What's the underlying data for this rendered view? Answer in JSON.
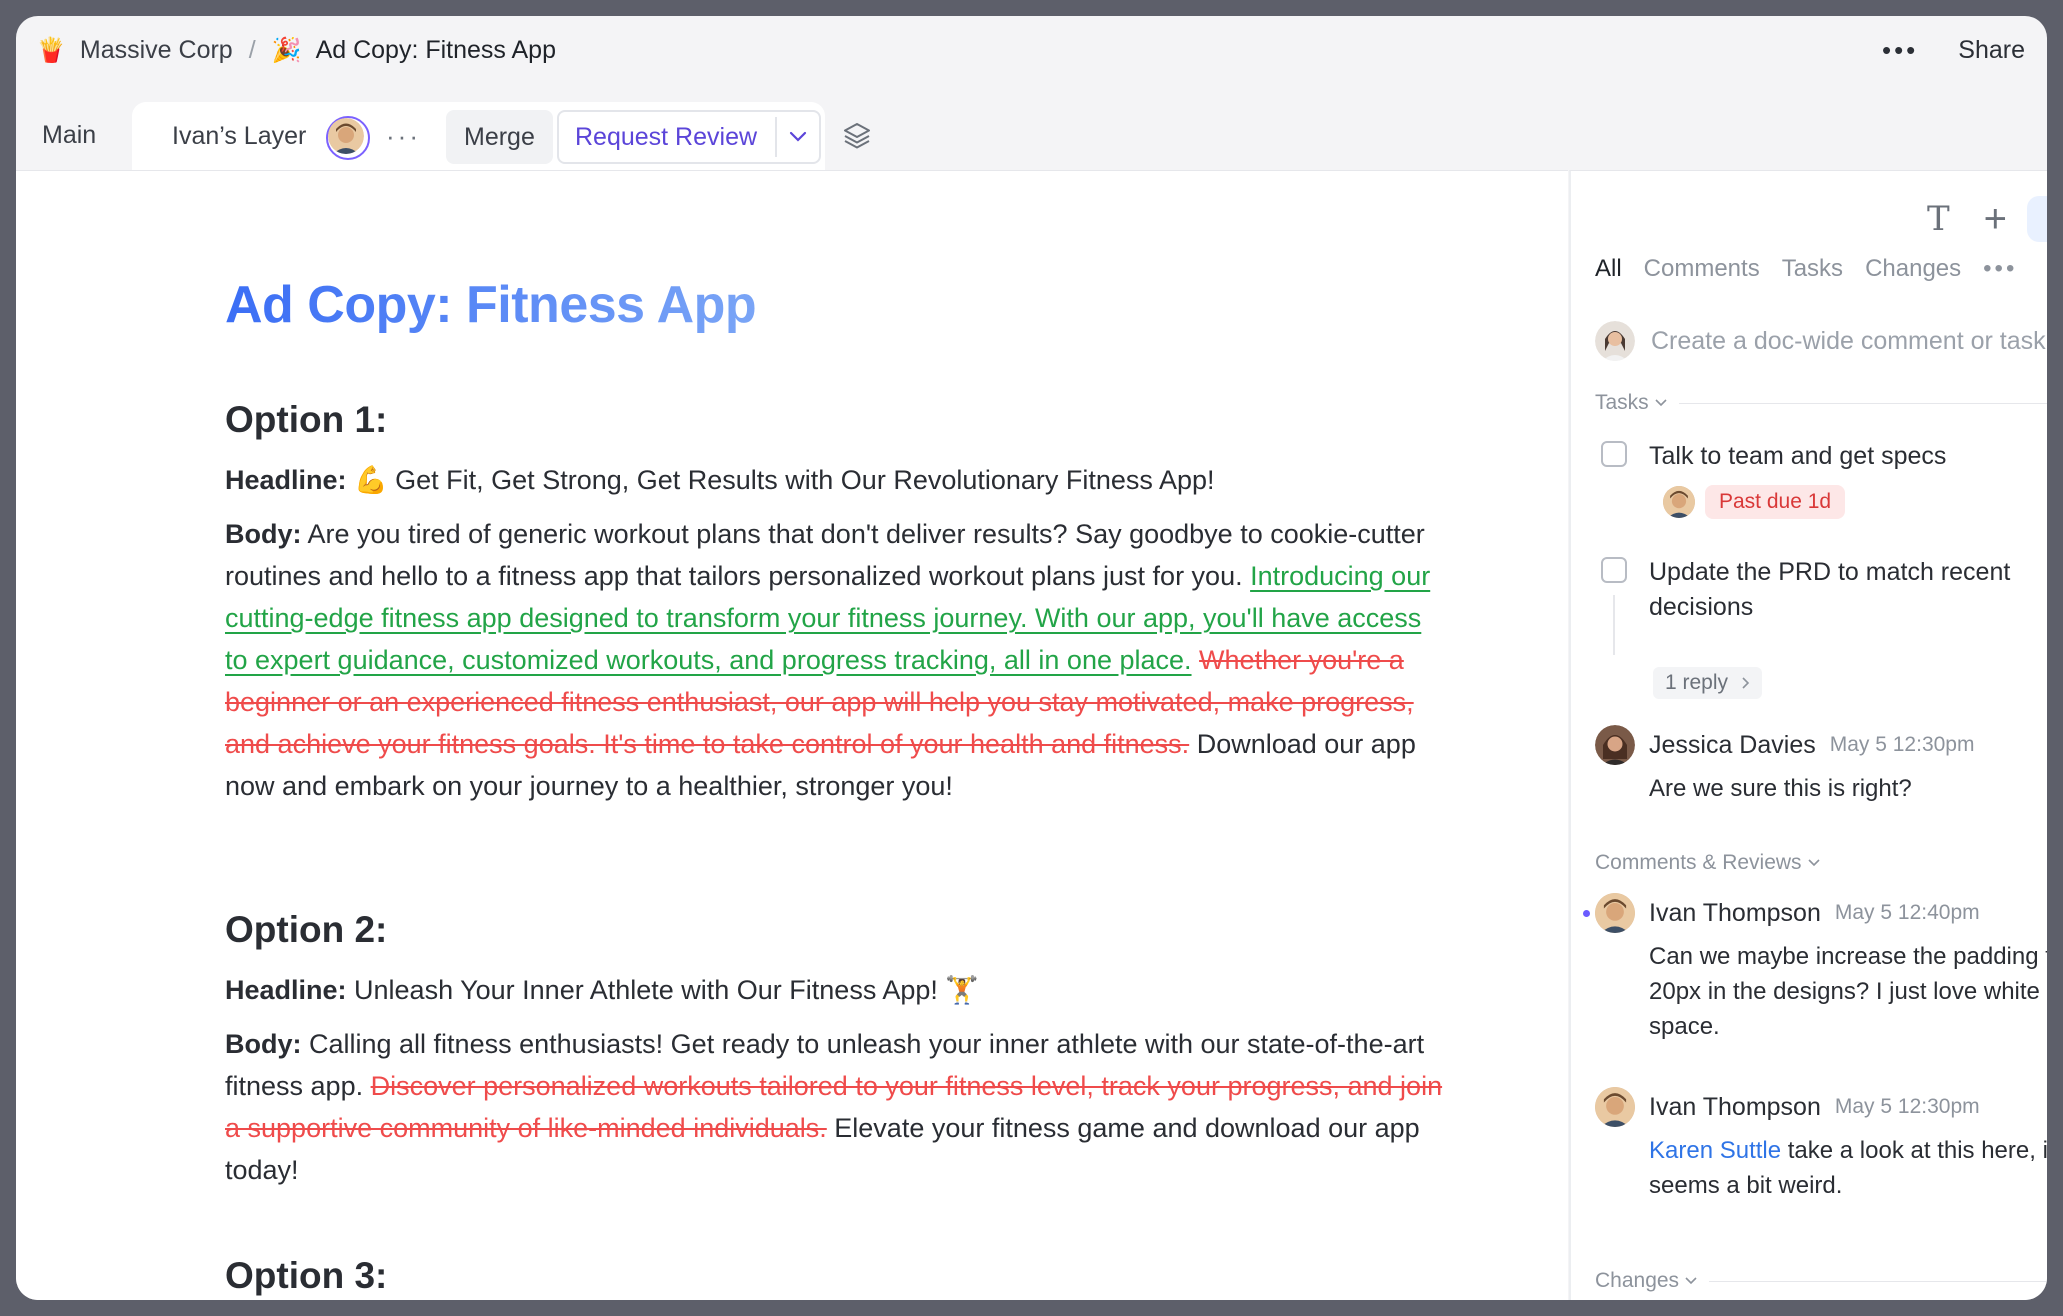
{
  "breadcrumb": {
    "workspace": "Massive Corp",
    "separator": "/",
    "document": "Ad Copy: Fitness App"
  },
  "topbar": {
    "more": "•••",
    "share": "Share"
  },
  "tabs": {
    "main": "Main",
    "layer": "Ivan’s Layer",
    "layer_more": "···",
    "merge": "Merge",
    "request_review": "Request Review"
  },
  "doc": {
    "title": "Ad Copy: Fitness App",
    "option1": {
      "heading": "Option 1:",
      "headline_label": "Headline:",
      "headline_text": " 💪 Get Fit, Get Strong, Get Results with Our Revolutionary Fitness App!",
      "body_label": "Body:",
      "body_plain1": " Are you tired of generic workout plans that don't deliver results? Say goodbye to cookie-cutter routines and hello to a fitness app that tailors personalized workout plans just for you. ",
      "body_inserted": "Introducing our cutting-edge fitness app designed to transform your fitness journey. With our app, you'll have access to expert guidance, customized workouts, and progress tracking, all in one place.",
      "body_space": " ",
      "body_deleted": "Whether you're a beginner or an experienced fitness enthusiast, our app will help you stay motivated, make progress, and achieve your fitness goals. It's time to take control of your health and fitness.",
      "body_plain2": " Download our app now and embark on your journey to a healthier, stronger you!"
    },
    "option2": {
      "heading": "Option 2:",
      "headline_label": "Headline:",
      "headline_text": " Unleash Your Inner Athlete with Our Fitness App! 🏋️",
      "body_label": "Body:",
      "body_plain1": " Calling all fitness enthusiasts! Get ready to unleash your inner athlete with our state-of-the-art fitness app. ",
      "body_deleted": "Discover personalized workouts tailored to your fitness level, track your progress, and join a supportive community of like-minded individuals.",
      "body_plain2": " Elevate your fitness game and download our app today!"
    },
    "option3": {
      "heading": "Option 3:"
    }
  },
  "panel": {
    "tabs": [
      "All",
      "Comments",
      "Tasks",
      "Changes"
    ],
    "tabs_more": "•••",
    "comment_placeholder": "Create a doc-wide comment or task",
    "tasks_label": "Tasks",
    "tasks": [
      {
        "text": "Talk to team and get specs",
        "badge": "Past due 1d"
      },
      {
        "text": "Update the PRD to match recent decisions",
        "reply": "1 reply"
      }
    ],
    "task_comment": {
      "name": "Jessica Davies",
      "time": "May 5 12:30pm",
      "body": "Are we sure this is right?"
    },
    "comments_label": "Comments & Reviews",
    "comments": [
      {
        "name": "Ivan Thompson",
        "time": "May 5 12:40pm",
        "body_lines": [
          "Can we maybe increase the padding to",
          "20px in the designs? I just love white",
          "space."
        ]
      },
      {
        "name": "Ivan Thompson",
        "time": "May 5 12:30pm",
        "mention": "Karen Suttle",
        "body_rest": " take a look at this here, it",
        "body_line2": "seems a bit weird."
      }
    ],
    "changes_label": "Changes"
  },
  "colors": {
    "accent": "#5b45d9",
    "inserted": "#22a447",
    "deleted": "#ef4b4b",
    "title_start": "#3b6ef5",
    "title_end": "#7aa5f6"
  }
}
